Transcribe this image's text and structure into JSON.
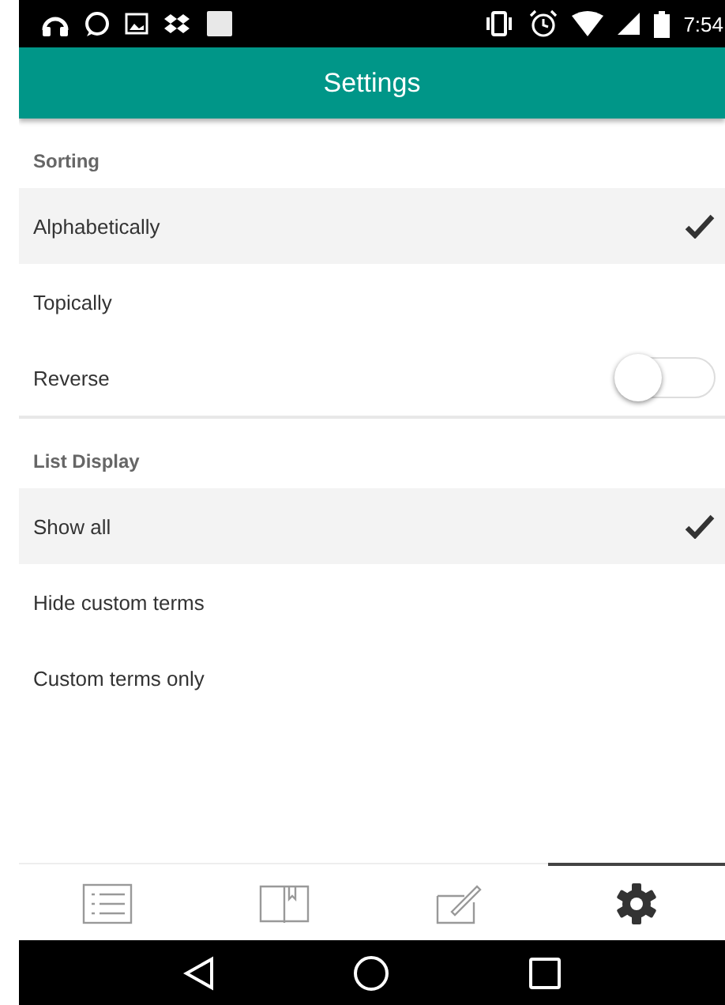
{
  "status_bar": {
    "time": "7:54"
  },
  "app_bar": {
    "title": "Settings"
  },
  "sections": [
    {
      "header": "Sorting",
      "items": [
        {
          "kind": "choice",
          "label": "Alphabetically",
          "selected": true
        },
        {
          "kind": "choice",
          "label": "Topically",
          "selected": false
        },
        {
          "kind": "toggle",
          "label": "Reverse",
          "on": false
        }
      ]
    },
    {
      "header": "List Display",
      "items": [
        {
          "kind": "choice",
          "label": "Show all",
          "selected": true
        },
        {
          "kind": "choice",
          "label": "Hide custom terms",
          "selected": false
        },
        {
          "kind": "choice",
          "label": "Custom terms only",
          "selected": false
        }
      ]
    }
  ],
  "bottom_tabs": [
    {
      "kind": "list",
      "selected": false
    },
    {
      "kind": "book",
      "selected": false
    },
    {
      "kind": "edit",
      "selected": false
    },
    {
      "kind": "settings",
      "selected": true
    }
  ]
}
